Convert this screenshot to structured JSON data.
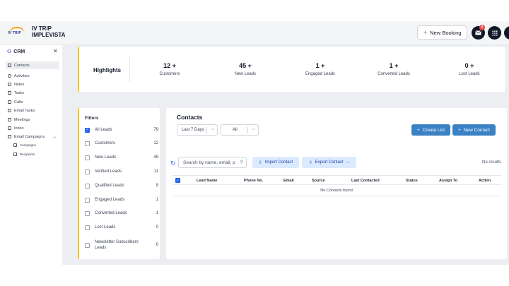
{
  "app": {
    "logo_text": "IV TRIP",
    "brand_line1": "IV TRIP",
    "brand_line2": "IMPLEVISTA",
    "new_booking_label": "New Booking",
    "notification_count": "0"
  },
  "sidebar": {
    "header": "CRM",
    "items": [
      {
        "label": "Contacts",
        "icon": "contacts-icon",
        "active": true
      },
      {
        "label": "Activities",
        "icon": "activity-icon"
      },
      {
        "label": "Notes",
        "icon": "notes-icon"
      },
      {
        "label": "Tasks",
        "icon": "tasks-icon"
      },
      {
        "label": "Calls",
        "icon": "phone-icon"
      },
      {
        "label": "Email Tasks",
        "icon": "email-icon"
      },
      {
        "label": "Meetings",
        "icon": "calendar-icon"
      },
      {
        "label": "Inbox",
        "icon": "inbox-icon"
      },
      {
        "label": "Email Campaigns",
        "icon": "campaign-icon"
      }
    ],
    "sub_items": [
      {
        "label": "Campaigns",
        "icon": "campaign-list-icon"
      },
      {
        "label": "Recipients",
        "icon": "recipients-icon"
      }
    ]
  },
  "highlights": {
    "title": "Highlights",
    "stats": [
      {
        "value": "12 +",
        "label": "Customers"
      },
      {
        "value": "45 +",
        "label": "New Leads"
      },
      {
        "value": "1 +",
        "label": "Engaged Leads"
      },
      {
        "value": "1 +",
        "label": "Converted Leads"
      },
      {
        "value": "0 +",
        "label": "Lost Leads"
      }
    ]
  },
  "filters": {
    "title": "Filters",
    "items": [
      {
        "label": "All Leads",
        "count": "79",
        "checked": true
      },
      {
        "label": "Customers",
        "count": "12"
      },
      {
        "label": "New Leads",
        "count": "45"
      },
      {
        "label": "Verified Leads",
        "count": "11"
      },
      {
        "label": "Qualified Leads",
        "count": "9"
      },
      {
        "label": "Engaged Leads",
        "count": "1"
      },
      {
        "label": "Converted Leads",
        "count": "1"
      },
      {
        "label": "Lost Leads",
        "count": "0"
      },
      {
        "label": "Newsletter Subscribers Leads",
        "count": "0"
      }
    ]
  },
  "contacts": {
    "title": "Contacts",
    "date_filter": "Last 7 Days",
    "type_filter": "All",
    "create_list_label": "Create List",
    "new_contact_label": "New Contact",
    "search_placeholder": "Search by name, email, p",
    "import_label": "Import Contact",
    "export_label": "Export Contact",
    "no_results": "No results",
    "columns": [
      "Lead Name",
      "Phone No.",
      "Email",
      "Source",
      "Last Contacted",
      "Status",
      "Assign To",
      "Action"
    ],
    "empty_message": "No Contacts found"
  },
  "colors": {
    "accent_yellow": "#f5c518",
    "primary_blue": "#3b82c4",
    "light_blue": "#dbeafe"
  }
}
